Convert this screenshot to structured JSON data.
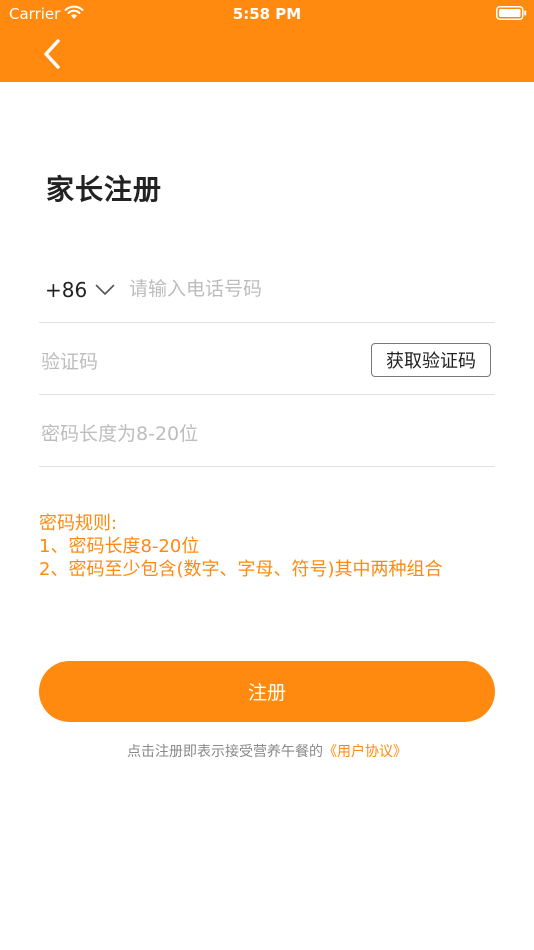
{
  "status_bar": {
    "carrier": "Carrier",
    "time": "5:58 PM"
  },
  "header": {
    "back_icon": "chevron-left-icon",
    "background_color": "#FF8A0F"
  },
  "page_title": "家长注册",
  "phone": {
    "country_code": "+86",
    "placeholder": "请输入电话号码"
  },
  "verification": {
    "placeholder": "验证码",
    "get_code_label": "获取验证码"
  },
  "password": {
    "placeholder": "密码长度为8-20位"
  },
  "rules": {
    "title": "密码规则:",
    "items": [
      "1、密码长度8-20位",
      "2、密码至少包含(数字、字母、符号)其中两种组合"
    ]
  },
  "register_label": "注册",
  "agreement": {
    "prefix": "点击注册即表示接受营养午餐的",
    "link": "《用户协议》"
  },
  "accent_color": "#FF8A0F"
}
